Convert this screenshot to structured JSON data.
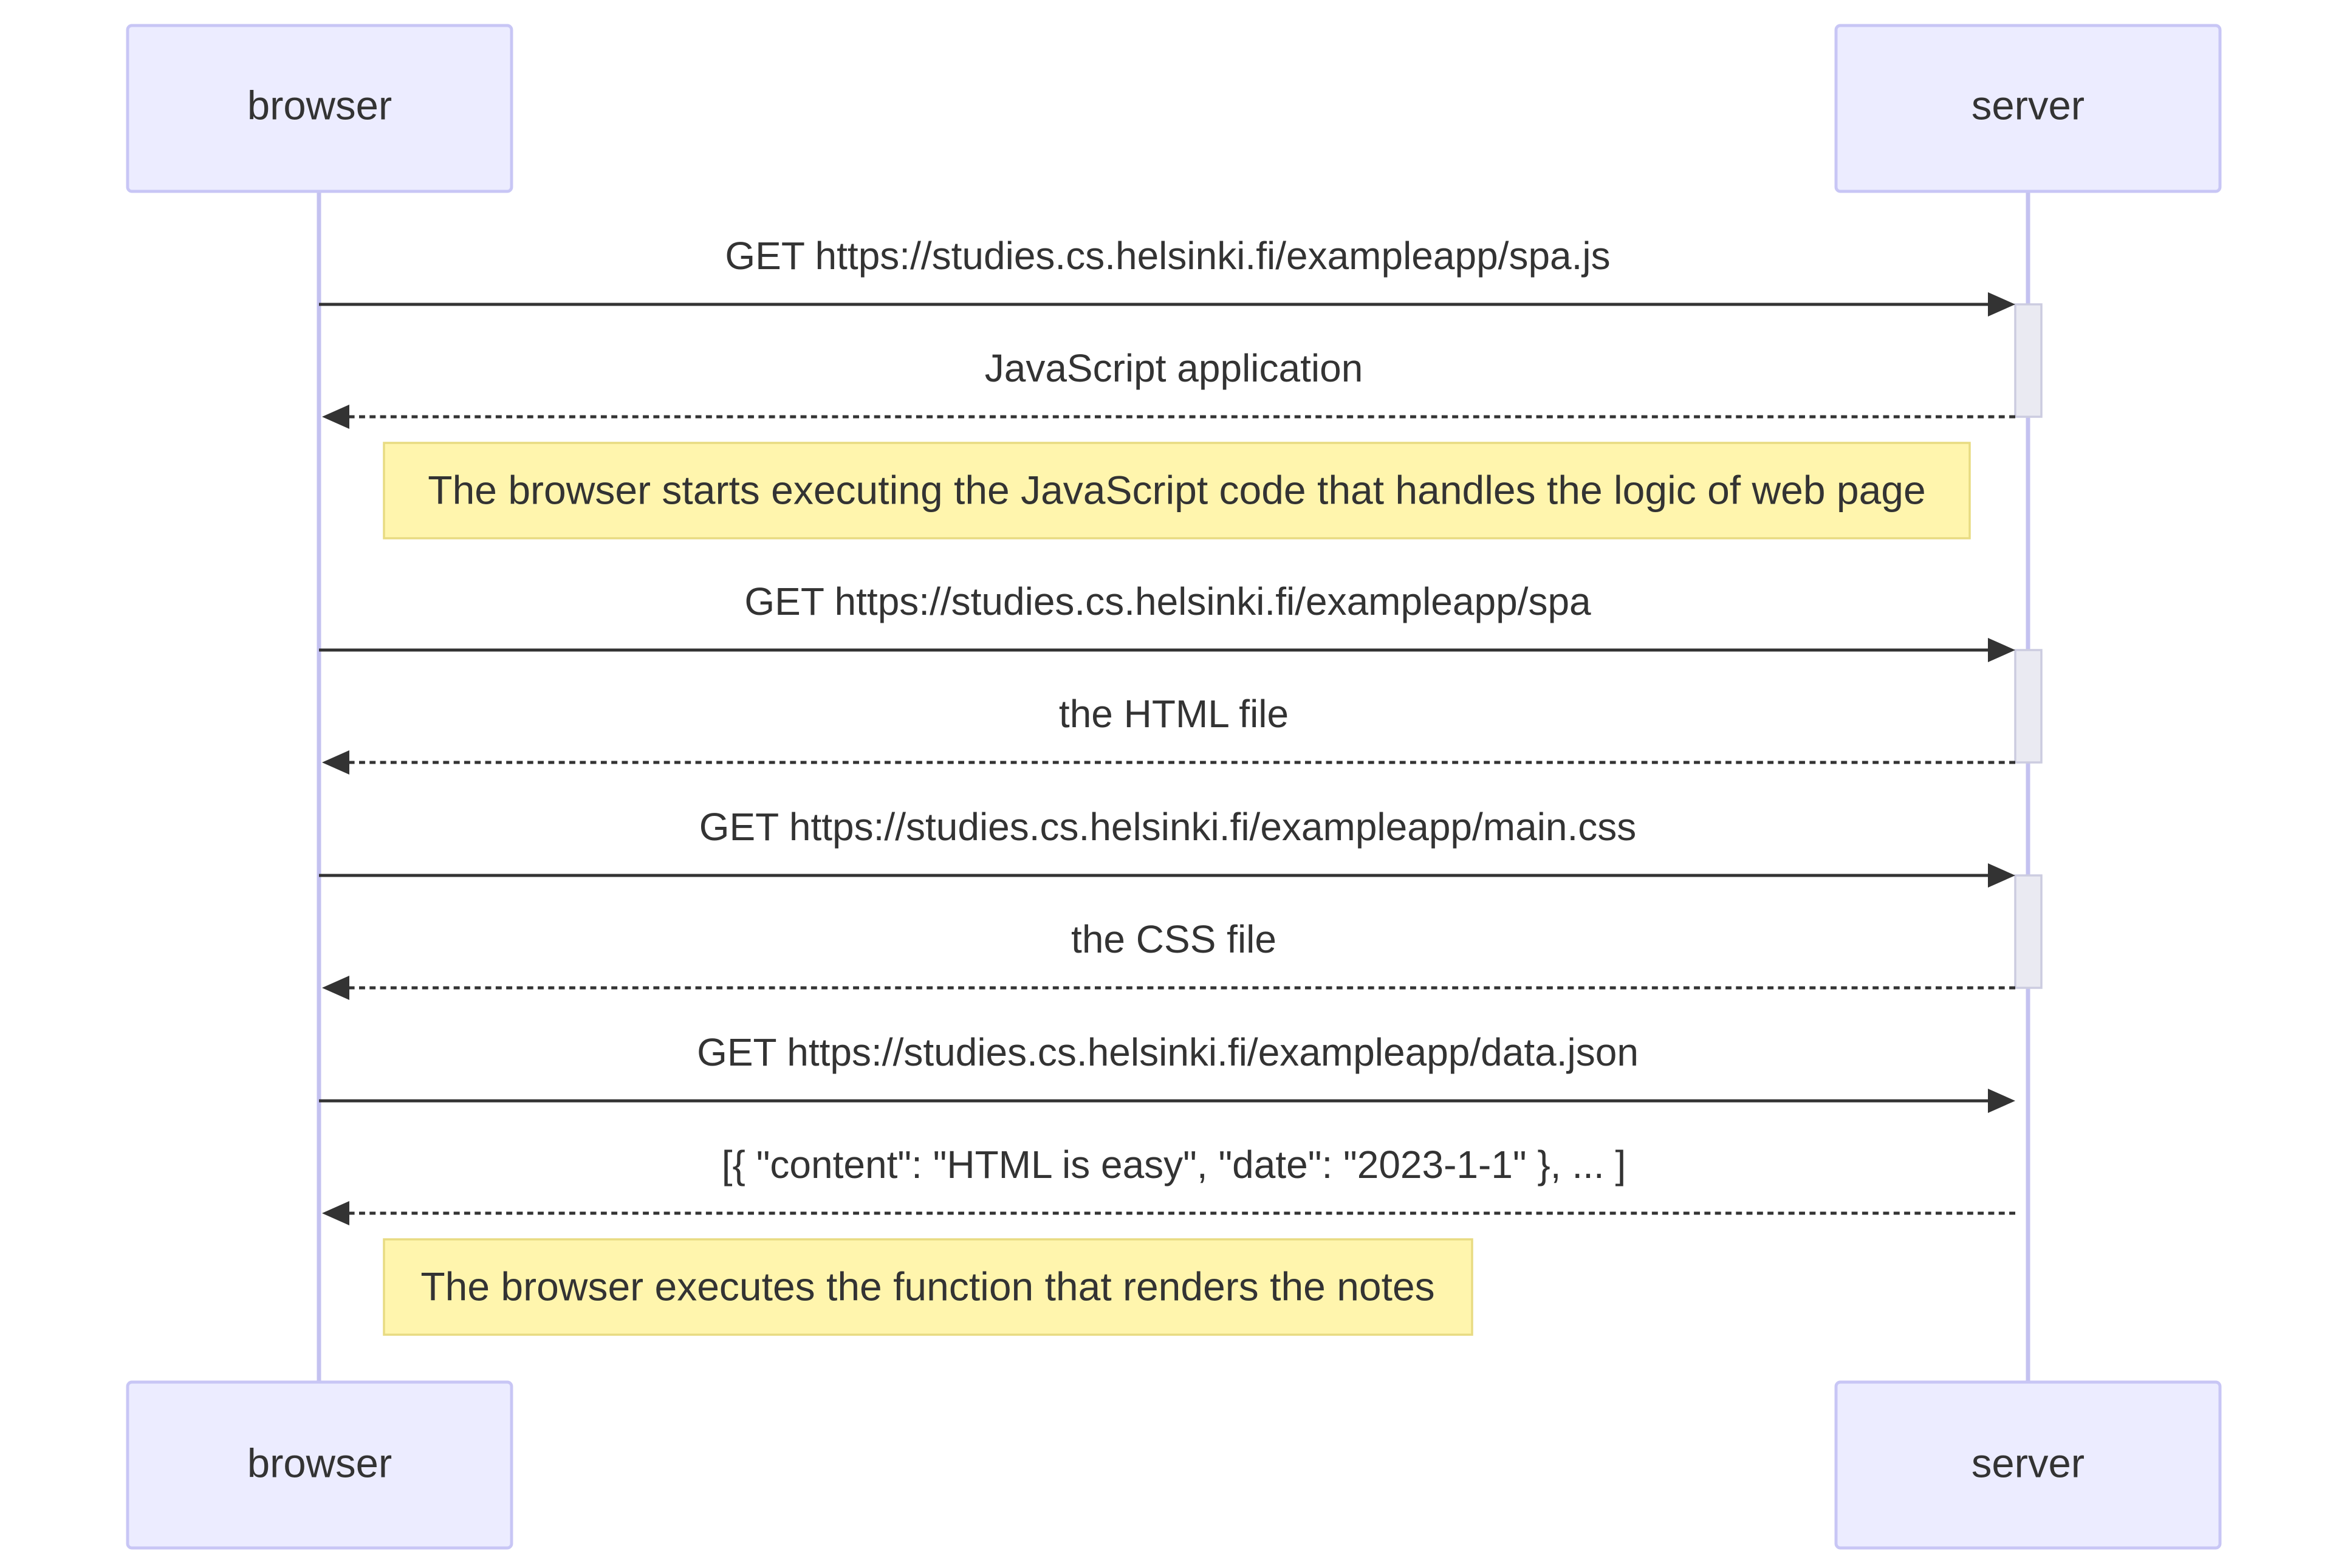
{
  "participants": {
    "browser": "browser",
    "server": "server"
  },
  "messages": [
    {
      "label": "GET https://studies.cs.helsinki.fi/exampleapp/spa.js",
      "from": "browser",
      "to": "server",
      "style": "solid"
    },
    {
      "label": "JavaScript application",
      "from": "server",
      "to": "browser",
      "style": "dashed"
    },
    {
      "label": "GET https://studies.cs.helsinki.fi/exampleapp/spa",
      "from": "browser",
      "to": "server",
      "style": "solid"
    },
    {
      "label": "the HTML file",
      "from": "server",
      "to": "browser",
      "style": "dashed"
    },
    {
      "label": "GET https://studies.cs.helsinki.fi/exampleapp/main.css",
      "from": "browser",
      "to": "server",
      "style": "solid"
    },
    {
      "label": "the CSS file",
      "from": "server",
      "to": "browser",
      "style": "dashed"
    },
    {
      "label": "GET https://studies.cs.helsinki.fi/exampleapp/data.json",
      "from": "browser",
      "to": "server",
      "style": "solid"
    },
    {
      "label": "[{ \"content\": \"HTML is easy\", \"date\": \"2023-1-1\" }, ... ]",
      "from": "server",
      "to": "browser",
      "style": "dashed"
    }
  ],
  "notes": [
    {
      "text": "The browser starts executing the JavaScript code that handles the logic of web page"
    },
    {
      "text": "The browser executes the function that renders the notes"
    }
  ],
  "colors": {
    "actor_fill": "#ECECFF",
    "actor_stroke": "#C8C6F5",
    "lifeline": "#C4C2F0",
    "note_fill": "#FFF5AD",
    "note_stroke": "#E8DB82",
    "line": "#333333"
  }
}
